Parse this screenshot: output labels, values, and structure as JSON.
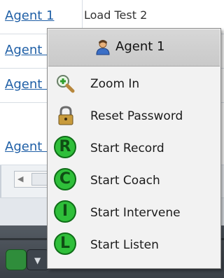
{
  "table": {
    "rows": [
      {
        "agent": "Agent 1",
        "second": "Load Test 2"
      },
      {
        "agent": "Agent 1"
      },
      {
        "agent": "Agent 1"
      },
      {
        "agent": "Agent 1"
      }
    ]
  },
  "context_menu": {
    "header": {
      "label": "Agent 1",
      "icon": "user-icon"
    },
    "items": [
      {
        "label": "Zoom In",
        "icon": "magnifier-icon"
      },
      {
        "label": "Reset Password",
        "icon": "padlock-icon"
      },
      {
        "label": "Start Record",
        "icon": "record-icon",
        "letter": "R"
      },
      {
        "label": "Start Coach",
        "icon": "coach-icon",
        "letter": "C"
      },
      {
        "label": "Start Intervene",
        "icon": "intervene-icon",
        "letter": "I"
      },
      {
        "label": "Start Listen",
        "icon": "listen-icon",
        "letter": "L"
      }
    ]
  },
  "colors": {
    "accent_green": "#2fbf3a",
    "link_blue": "#1f5fa6"
  }
}
